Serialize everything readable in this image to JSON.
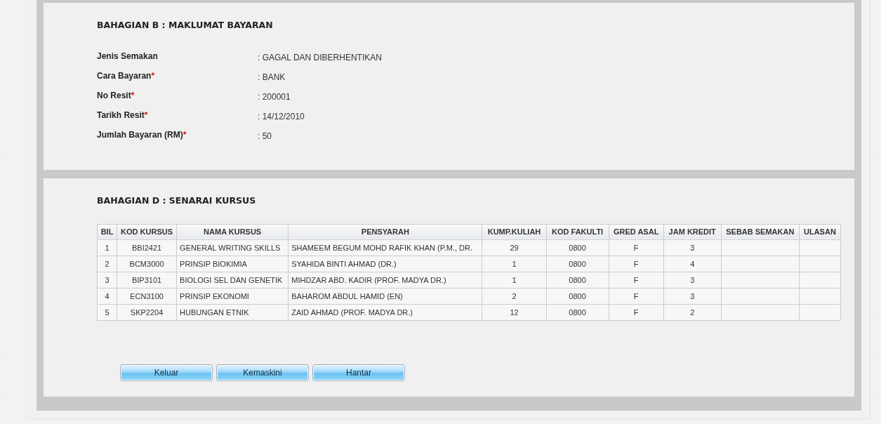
{
  "payment_section": {
    "title": "BAHAGIAN B : MAKLUMAT BAYARAN",
    "required_marker": "*",
    "fields": [
      {
        "label": "Jenis Semakan",
        "required": false,
        "value": ": GAGAL DAN DIBERHENTIKAN"
      },
      {
        "label": "Cara Bayaran",
        "required": true,
        "value": ": BANK"
      },
      {
        "label": "No Resit",
        "required": true,
        "value": ": 200001"
      },
      {
        "label": "Tarikh Resit",
        "required": true,
        "value": ": 14/12/2010"
      },
      {
        "label": "Jumlah Bayaran (RM)",
        "required": true,
        "value": ": 50"
      }
    ]
  },
  "course_section": {
    "title": "BAHAGIAN D : SENARAI KURSUS",
    "table": {
      "columns": [
        "BIL",
        "KOD KURSUS",
        "NAMA KURSUS",
        "PENSYARAH",
        "KUMP.KULIAH",
        "KOD FAKULTI",
        "GRED ASAL",
        "JAM KREDIT",
        "SEBAB SEMAKAN",
        "ULASAN"
      ],
      "rows": [
        [
          "1",
          "BBI2421",
          "GENERAL WRITING SKILLS",
          "SHAMEEM BEGUM MOHD RAFIK KHAN (P.M., DR.",
          "29",
          "0800",
          "F",
          "3"
        ],
        [
          "2",
          "BCM3000",
          "PRINSIP BIOKIMIA",
          "SYAHIDA BINTI AHMAD (DR.)",
          "1",
          "0800",
          "F",
          "4"
        ],
        [
          "3",
          "BIP3101",
          "BIOLOGI SEL DAN GENETIK",
          "MIHDZAR ABD. KADIR (PROF. MADYA DR.)",
          "1",
          "0800",
          "F",
          "3"
        ],
        [
          "4",
          "ECN3100",
          "PRINSIP EKONOMI",
          "BAHAROM ABDUL HAMID (EN)",
          "2",
          "0800",
          "F",
          "3"
        ],
        [
          "5",
          "SKP2204",
          "HUBUNGAN ETNIK",
          "ZAID AHMAD (PROF. MADYA DR.)",
          "12",
          "0800",
          "F",
          "2"
        ]
      ]
    }
  },
  "buttons": [
    "Keluar",
    "Kemaskini",
    "Hantar"
  ]
}
